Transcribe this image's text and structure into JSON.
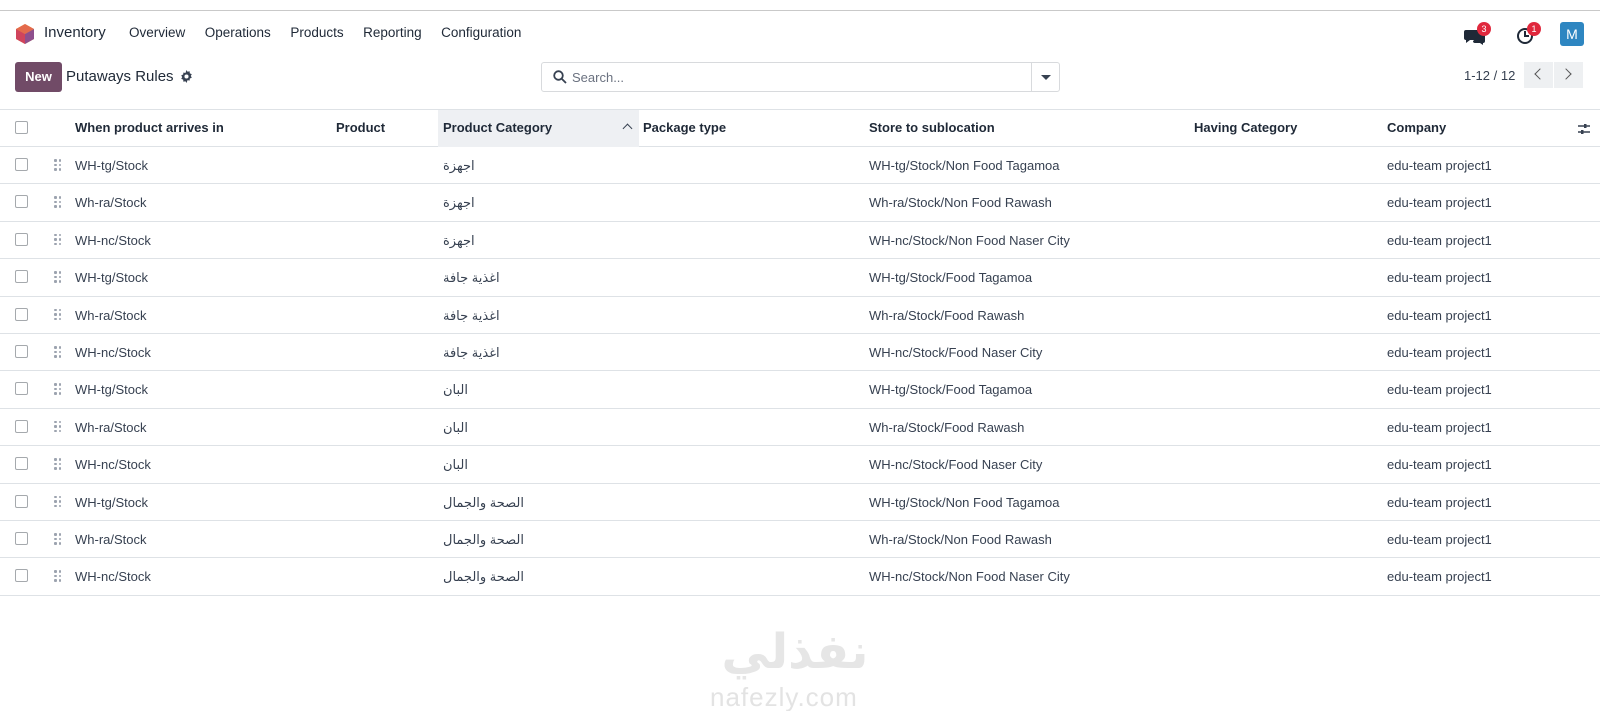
{
  "app": {
    "name": "Inventory"
  },
  "menu": [
    "Overview",
    "Operations",
    "Products",
    "Reporting",
    "Configuration"
  ],
  "systray": {
    "messages_count": "3",
    "activities_count": "1",
    "avatar_letter": "M"
  },
  "control": {
    "new_label": "New",
    "breadcrumb": "Putaways Rules",
    "search_placeholder": "Search...",
    "pager": "1-12 / 12"
  },
  "table": {
    "columns": [
      "When product arrives in",
      "Product",
      "Product Category",
      "Package type",
      "Store to sublocation",
      "Having Category",
      "Company"
    ],
    "sorted_column": "Product Category",
    "rows": [
      [
        "WH-tg/Stock",
        "",
        "اجهزة",
        "",
        "WH-tg/Stock/Non Food Tagamoa",
        "",
        "edu-team project1"
      ],
      [
        "Wh-ra/Stock",
        "",
        "اجهزة",
        "",
        "Wh-ra/Stock/Non Food Rawash",
        "",
        "edu-team project1"
      ],
      [
        "WH-nc/Stock",
        "",
        "اجهزة",
        "",
        "WH-nc/Stock/Non Food Naser City",
        "",
        "edu-team project1"
      ],
      [
        "WH-tg/Stock",
        "",
        "اغذية جافة",
        "",
        "WH-tg/Stock/Food Tagamoa",
        "",
        "edu-team project1"
      ],
      [
        "Wh-ra/Stock",
        "",
        "اغذية جافة",
        "",
        "Wh-ra/Stock/Food Rawash",
        "",
        "edu-team project1"
      ],
      [
        "WH-nc/Stock",
        "",
        "اغذية جافة",
        "",
        "WH-nc/Stock/Food Naser City",
        "",
        "edu-team project1"
      ],
      [
        "WH-tg/Stock",
        "",
        "البان",
        "",
        "WH-tg/Stock/Food Tagamoa",
        "",
        "edu-team project1"
      ],
      [
        "Wh-ra/Stock",
        "",
        "البان",
        "",
        "Wh-ra/Stock/Food Rawash",
        "",
        "edu-team project1"
      ],
      [
        "WH-nc/Stock",
        "",
        "البان",
        "",
        "WH-nc/Stock/Food Naser City",
        "",
        "edu-team project1"
      ],
      [
        "WH-tg/Stock",
        "",
        "الصحة والجمال",
        "",
        "WH-tg/Stock/Non Food Tagamoa",
        "",
        "edu-team project1"
      ],
      [
        "Wh-ra/Stock",
        "",
        "الصحة والجمال",
        "",
        "Wh-ra/Stock/Non Food Rawash",
        "",
        "edu-team project1"
      ],
      [
        "WH-nc/Stock",
        "",
        "الصحة والجمال",
        "",
        "WH-nc/Stock/Non Food Naser City",
        "",
        "edu-team project1"
      ]
    ]
  },
  "watermark": {
    "arabic": "نفذلي",
    "latin": "nafezly.com"
  },
  "colors": {
    "primary": "#714b67",
    "badge": "#e0283d",
    "avatar": "#2e86c1"
  }
}
